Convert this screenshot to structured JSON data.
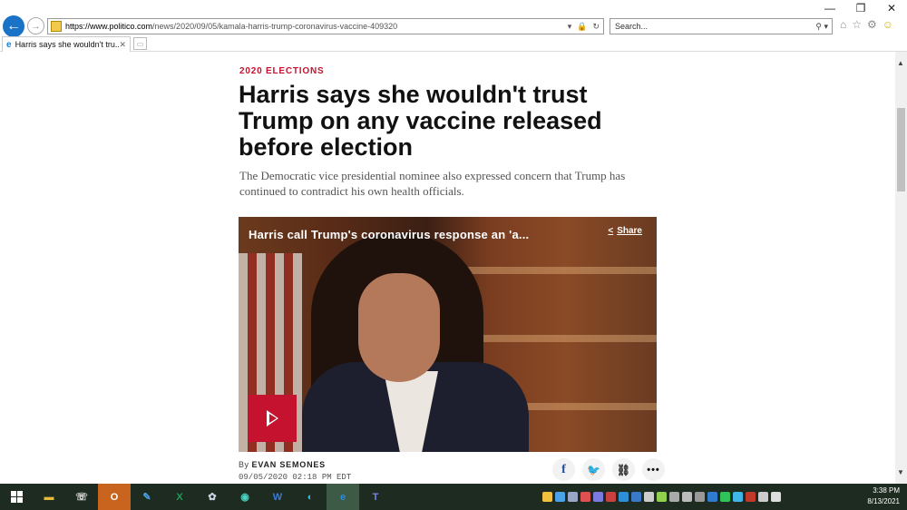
{
  "browser": {
    "window_controls": {
      "minimize": "—",
      "restore": "❐",
      "close": "✕"
    },
    "address_url_host": "https://www.politico.com",
    "address_url_path": "/news/2020/09/05/kamala-harris-trump-coronavirus-vaccine-409320",
    "search_placeholder": "Search...",
    "tab_label": "Harris says she wouldn't tru...",
    "tab_close": "✕"
  },
  "article": {
    "kicker": "2020 ELECTIONS",
    "headline": "Harris says she wouldn't trust Trump on any vaccine released before election",
    "dek": "The Democratic vice presidential nominee also expressed concern that Trump has continued to contradict his own health officials.",
    "video_title": "Harris call Trump's coronavirus response an 'a...",
    "video_share_label": "Share",
    "byline_prefix": "By",
    "author": "EVAN SEMONES",
    "date": "09/05/2020 02:18 PM EDT",
    "social": {
      "facebook": "f",
      "twitter": "t",
      "link": "⛓",
      "more": "•••"
    }
  },
  "taskbar": {
    "time": "3:38 PM",
    "date": "8/13/2021",
    "apps": [
      {
        "name": "file-explorer",
        "glyph": "▬",
        "color": "#e8b93a"
      },
      {
        "name": "phone",
        "glyph": "☏",
        "color": "#dddddd"
      },
      {
        "name": "outlook",
        "glyph": "O",
        "color": "#ffffff"
      },
      {
        "name": "pen",
        "glyph": "✎",
        "color": "#4a9fe0"
      },
      {
        "name": "excel",
        "glyph": "X",
        "color": "#1f9d55"
      },
      {
        "name": "paint",
        "glyph": "✿",
        "color": "#cfd7e6"
      },
      {
        "name": "camera",
        "glyph": "◉",
        "color": "#4ad0c0"
      },
      {
        "name": "word",
        "glyph": "W",
        "color": "#3b7bd4"
      },
      {
        "name": "edge",
        "glyph": "◐",
        "color": "#3fb5e8"
      },
      {
        "name": "internet-explorer",
        "glyph": "e",
        "color": "#2a8ee6"
      },
      {
        "name": "teams",
        "glyph": "T",
        "color": "#7b83eb"
      }
    ]
  }
}
